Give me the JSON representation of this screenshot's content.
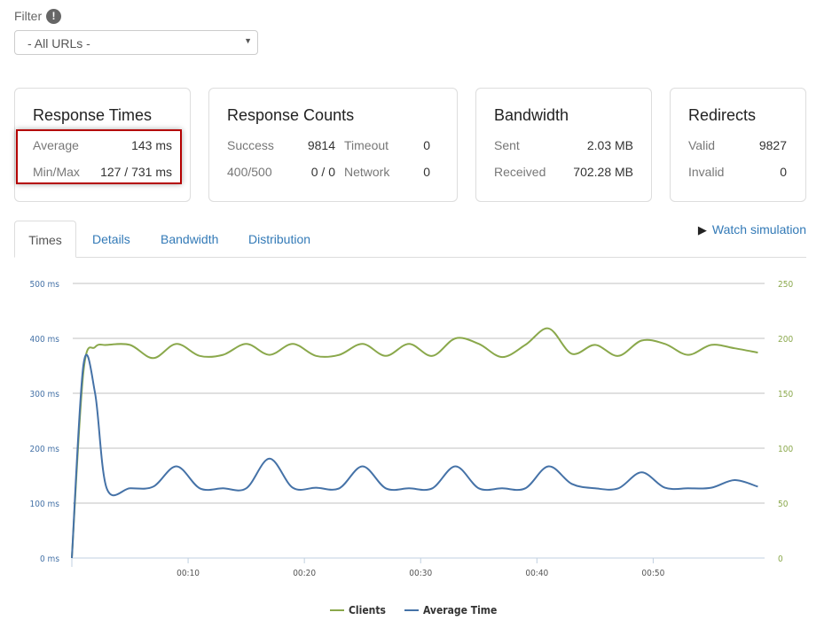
{
  "filter": {
    "label": "Filter",
    "icon": "info-icon",
    "info_glyph": "!",
    "selected": "- All URLs -"
  },
  "cards": {
    "response_times": {
      "title": "Response Times",
      "average_label": "Average",
      "average": "143 ms",
      "minmax_label": "Min/Max",
      "minmax": "127 / 731 ms"
    },
    "response_counts": {
      "title": "Response Counts",
      "success_label": "Success",
      "success": "9814",
      "timeout_label": "Timeout",
      "timeout": "0",
      "errors_label": "400/500",
      "errors": "0 / 0",
      "network_label": "Network",
      "network": "0"
    },
    "bandwidth": {
      "title": "Bandwidth",
      "sent_label": "Sent",
      "sent": "2.03 MB",
      "received_label": "Received",
      "received": "702.28 MB"
    },
    "redirects": {
      "title": "Redirects",
      "valid_label": "Valid",
      "valid": "9827",
      "invalid_label": "Invalid",
      "invalid": "0"
    }
  },
  "tabs": [
    {
      "label": "Times",
      "active": true
    },
    {
      "label": "Details"
    },
    {
      "label": "Bandwidth"
    },
    {
      "label": "Distribution"
    }
  ],
  "watch_simulation": "Watch simulation",
  "colors": {
    "clients": "#8aa84b",
    "average_time": "#4572a7",
    "highlight": "#b40000",
    "link": "#337ab7"
  },
  "chart_data": {
    "type": "line",
    "x_ticks": [
      "00:10",
      "00:20",
      "00:30",
      "00:40",
      "00:50"
    ],
    "x_tick_values": [
      10,
      20,
      30,
      40,
      50
    ],
    "xlim": [
      0,
      59.2
    ],
    "y_left_ticks": [
      "0 ms",
      "100 ms",
      "200 ms",
      "300 ms",
      "400 ms",
      "500 ms"
    ],
    "y_left_lim": [
      0,
      500
    ],
    "y_right_ticks": [
      "0",
      "50",
      "100",
      "150",
      "200",
      "250"
    ],
    "y_right_lim": [
      0,
      250
    ],
    "grid": true,
    "legend": "bottom-center",
    "series": [
      {
        "name": "Clients",
        "axis": "right",
        "color": "#8aa84b",
        "x": [
          0,
          1,
          2,
          3,
          5,
          7,
          9,
          11,
          13,
          15,
          17,
          19,
          21,
          23,
          25,
          27,
          29,
          31,
          33,
          35,
          37,
          39,
          41,
          43,
          45,
          47,
          49,
          51,
          53,
          55,
          57,
          59
        ],
        "values": [
          0,
          170,
          192,
          194,
          194,
          182,
          195,
          184,
          185,
          195,
          185,
          195,
          184,
          185,
          195,
          184,
          195,
          184,
          200,
          195,
          183,
          194,
          209,
          186,
          194,
          184,
          198,
          195,
          185,
          194,
          191,
          187
        ]
      },
      {
        "name": "Average Time",
        "axis": "left",
        "color": "#4572a7",
        "x": [
          0,
          1,
          2,
          3,
          5,
          7,
          9,
          11,
          13,
          15,
          17,
          19,
          21,
          23,
          25,
          27,
          29,
          31,
          33,
          35,
          37,
          39,
          41,
          43,
          45,
          47,
          49,
          51,
          53,
          55,
          57,
          59
        ],
        "values": [
          0,
          352,
          300,
          127,
          127,
          130,
          167,
          127,
          127,
          127,
          181,
          128,
          128,
          127,
          167,
          127,
          127,
          127,
          167,
          127,
          127,
          127,
          167,
          135,
          127,
          127,
          156,
          128,
          127,
          128,
          142,
          130
        ]
      }
    ]
  }
}
